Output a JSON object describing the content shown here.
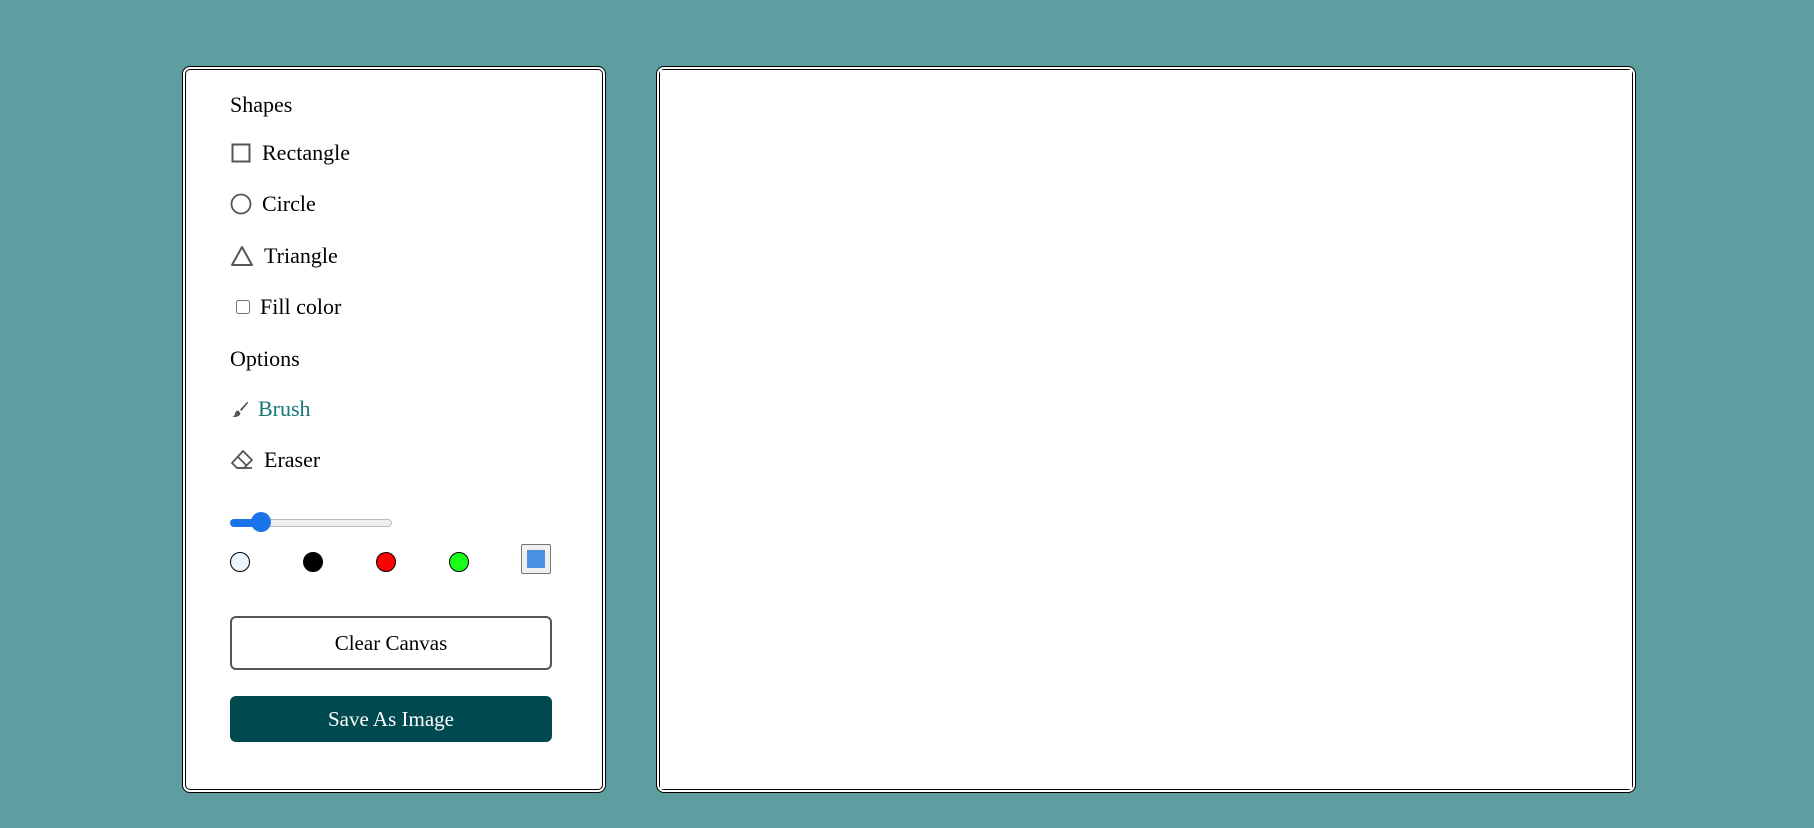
{
  "shapes": {
    "title": "Shapes",
    "rectangle_label": "Rectangle",
    "circle_label": "Circle",
    "triangle_label": "Triangle",
    "fill_color_label": "Fill color",
    "fill_color_checked": false
  },
  "options": {
    "title": "Options",
    "brush_label": "Brush",
    "brush_active": true,
    "eraser_label": "Eraser"
  },
  "brush_size": {
    "level_fraction": 0.15
  },
  "colors": {
    "swatches": [
      "#eef4fb",
      "#000000",
      "#ff0000",
      "#1aff1a"
    ],
    "picker_value": "#4a90e2",
    "active_accent": "#18777a"
  },
  "buttons": {
    "clear_label": "Clear Canvas",
    "save_label": "Save As Image"
  },
  "icons": {
    "rectangle": "square-outline-icon",
    "circle": "circle-outline-icon",
    "triangle": "triangle-outline-icon",
    "brush": "paintbrush-icon",
    "eraser": "eraser-icon"
  }
}
